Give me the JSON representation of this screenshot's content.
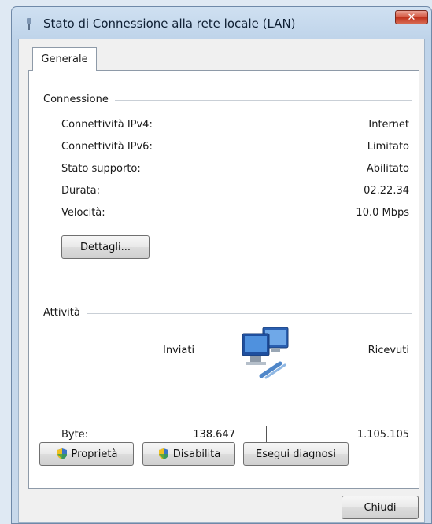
{
  "window": {
    "title": "Stato di Connessione alla rete locale (LAN)",
    "close_glyph": "✕"
  },
  "tabs": [
    {
      "label": "Generale"
    }
  ],
  "connection": {
    "section_title": "Connessione",
    "rows": [
      {
        "label": "Connettività IPv4:",
        "value": "Internet"
      },
      {
        "label": "Connettività IPv6:",
        "value": "Limitato"
      },
      {
        "label": "Stato supporto:",
        "value": "Abilitato"
      },
      {
        "label": "Durata:",
        "value": "02.22.34"
      },
      {
        "label": "Velocità:",
        "value": "10.0 Mbps"
      }
    ],
    "details_button": "Dettagli..."
  },
  "activity": {
    "section_title": "Attività",
    "sent_label": "Inviati",
    "received_label": "Ricevuti",
    "bytes_label": "Byte:",
    "bytes_sent": "138.647",
    "bytes_received": "1.105.105",
    "icon": "network-computers-icon"
  },
  "buttons": {
    "properties": "Proprietà",
    "disable": "Disabilita",
    "diagnose": "Esegui diagnosi",
    "close": "Chiudi"
  }
}
